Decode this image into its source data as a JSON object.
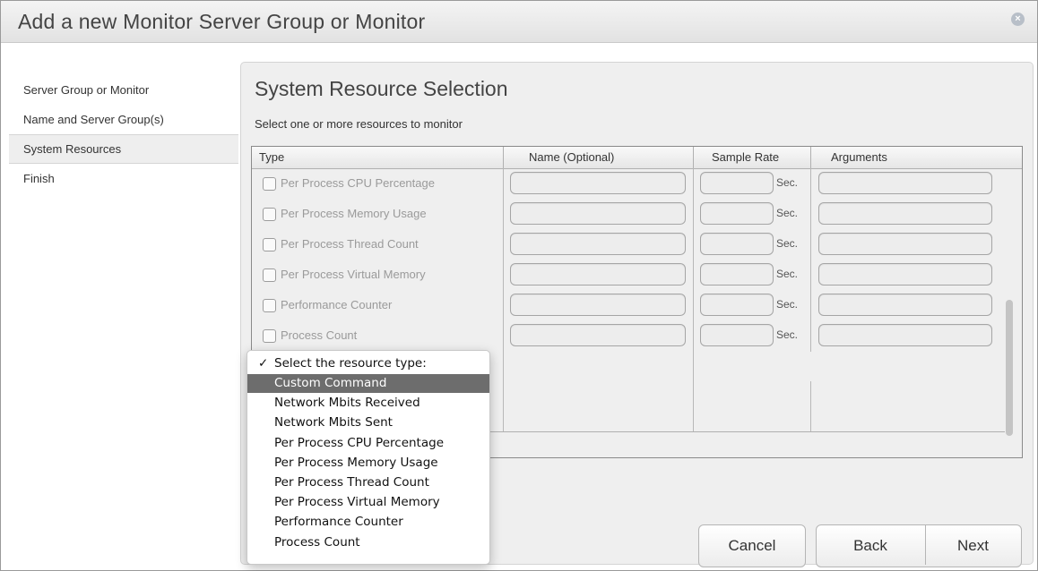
{
  "window": {
    "title": "Add a new Monitor Server Group or Monitor",
    "close_icon": "close-icon"
  },
  "sidebar": {
    "items": [
      {
        "label": "Server Group or Monitor",
        "active": false
      },
      {
        "label": "Name and Server Group(s)",
        "active": false
      },
      {
        "label": "System Resources",
        "active": true
      },
      {
        "label": "Finish",
        "active": false
      }
    ]
  },
  "main": {
    "heading": "System Resource Selection",
    "subtitle": "Select one or more resources to monitor",
    "table": {
      "columns": [
        "Type",
        "Name (Optional)",
        "Sample Rate",
        "Arguments"
      ],
      "sec_label": "Sec.",
      "rows": [
        {
          "label": "Per Process CPU Percentage",
          "checked": false
        },
        {
          "label": "Per Process Memory Usage",
          "checked": false
        },
        {
          "label": "Per Process Thread Count",
          "checked": false
        },
        {
          "label": "Per Process Virtual Memory",
          "checked": false
        },
        {
          "label": "Performance Counter",
          "checked": false
        },
        {
          "label": "Process Count",
          "checked": false
        }
      ]
    }
  },
  "dropdown": {
    "header": "Select the resource type:",
    "check_mark": "✓",
    "highlighted_index": 0,
    "options": [
      "Custom Command",
      "Network Mbits Received",
      "Network Mbits Sent",
      "Per Process CPU Percentage",
      "Per Process Memory Usage",
      "Per Process Thread Count",
      "Per Process Virtual Memory",
      "Performance Counter",
      "Process Count"
    ]
  },
  "footer": {
    "cancel_label": "Cancel",
    "back_label": "Back",
    "next_label": "Next"
  },
  "colors": {
    "menu_highlight": "#6d6d6d",
    "panel_bg": "#efefef",
    "disabled_text": "#9a9a9a"
  }
}
